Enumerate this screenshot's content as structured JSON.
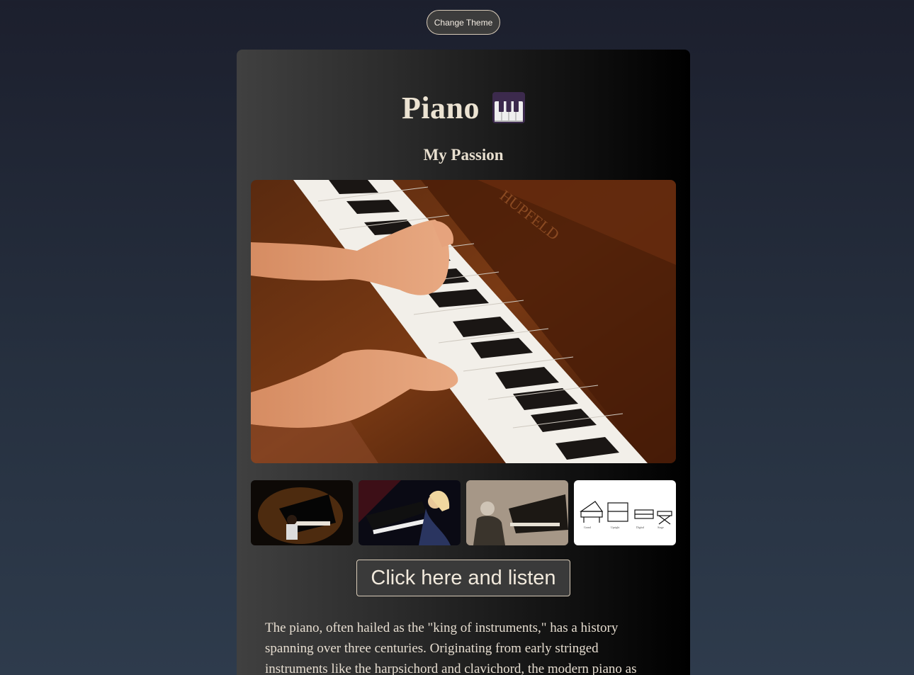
{
  "header": {
    "theme_button_label": "Change Theme"
  },
  "card": {
    "title": "Piano",
    "title_icon": "piano-keys-icon",
    "subtitle": "My Passion",
    "hero_image": "hands-playing-upright-piano",
    "thumbnails": [
      {
        "name": "pianist-on-stage-grand-piano"
      },
      {
        "name": "woman-playing-grand-piano-stage-lights"
      },
      {
        "name": "vintage-pianist-photo"
      },
      {
        "name": "piano-types-illustration"
      }
    ],
    "listen_button_label": "Click here and listen",
    "description": "The piano, often hailed as the \"king of instruments,\" has a history spanning over three centuries. Originating from early stringed instruments like the harpsichord and clavichord, the modern piano as"
  },
  "colors": {
    "accent_text": "#ece3d2",
    "button_border": "#d8cbb8"
  }
}
